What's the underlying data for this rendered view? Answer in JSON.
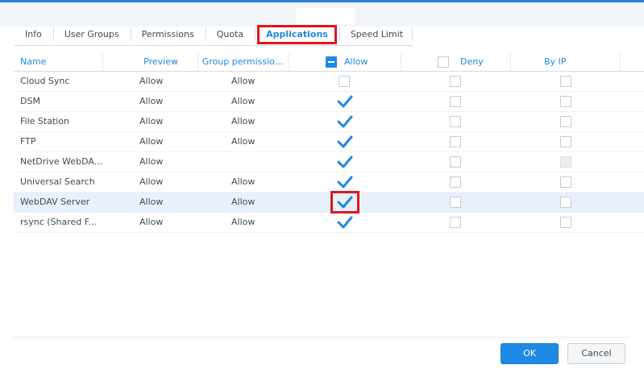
{
  "tabs": [
    {
      "label": "Info"
    },
    {
      "label": "User Groups"
    },
    {
      "label": "Permissions"
    },
    {
      "label": "Quota"
    },
    {
      "label": "Applications"
    },
    {
      "label": "Speed Limit"
    }
  ],
  "active_tab": "Applications",
  "columns": {
    "name": "Name",
    "preview": "Preview",
    "group": "Group permissio...",
    "allow": "Allow",
    "deny": "Deny",
    "byip": "By IP"
  },
  "header_checkbox_state": {
    "allow": "partial",
    "deny": "unchecked"
  },
  "rows": [
    {
      "name": "Cloud Sync",
      "preview": "Allow",
      "group": "Allow",
      "allow": false,
      "deny": false,
      "byip": false,
      "byip_disabled": false
    },
    {
      "name": "DSM",
      "preview": "Allow",
      "group": "Allow",
      "allow": true,
      "deny": false,
      "byip": false,
      "byip_disabled": false
    },
    {
      "name": "File Station",
      "preview": "Allow",
      "group": "Allow",
      "allow": true,
      "deny": false,
      "byip": false,
      "byip_disabled": false
    },
    {
      "name": "FTP",
      "preview": "Allow",
      "group": "Allow",
      "allow": true,
      "deny": false,
      "byip": false,
      "byip_disabled": false
    },
    {
      "name": "NetDrive WebDA...",
      "preview": "Allow",
      "group": "",
      "allow": true,
      "deny": false,
      "byip": false,
      "byip_disabled": true
    },
    {
      "name": "Universal Search",
      "preview": "Allow",
      "group": "Allow",
      "allow": true,
      "deny": false,
      "byip": false,
      "byip_disabled": false
    },
    {
      "name": "WebDAV Server",
      "preview": "Allow",
      "group": "Allow",
      "allow": true,
      "deny": false,
      "byip": false,
      "byip_disabled": false,
      "selected": true
    },
    {
      "name": "rsync (Shared F...",
      "preview": "Allow",
      "group": "Allow",
      "allow": true,
      "deny": false,
      "byip": false,
      "byip_disabled": false
    }
  ],
  "buttons": {
    "ok": "OK",
    "cancel": "Cancel"
  },
  "colors": {
    "accent": "#1e88e5",
    "highlight": "#e3141c",
    "selected_row": "#e6f1fb"
  }
}
